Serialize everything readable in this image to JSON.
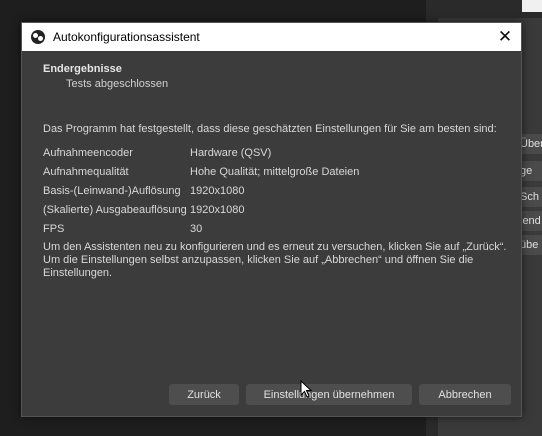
{
  "background": {
    "side_buttons": [
      "Über",
      "ge",
      "Sch",
      "lend",
      "übe"
    ]
  },
  "dialog": {
    "title": "Autokonfigurationsassistent",
    "close_glyph": "✕",
    "heading": "Endergebnisse",
    "subheading": "Tests abgeschlossen",
    "intro": "Das Programm hat festgestellt, dass diese geschätzten Einstellungen für Sie am besten sind:",
    "settings": [
      {
        "key": "Aufnahmeencoder",
        "value": "Hardware (QSV)"
      },
      {
        "key": "Aufnahmequalität",
        "value": "Hohe Qualität; mittelgroße Dateien"
      },
      {
        "key": "Basis-(Leinwand-)Auflösung",
        "value": "1920x1080"
      },
      {
        "key": "(Skalierte) Ausgabeauflösung",
        "value": "1920x1080"
      },
      {
        "key": "FPS",
        "value": "30"
      }
    ],
    "notice": "Um den Assistenten neu zu konfigurieren und es erneut zu versuchen, klicken Sie auf „Zurück“. Um die Einstellungen selbst anzupassen, klicken Sie auf „Abbrechen“ und öffnen Sie die Einstellungen.",
    "buttons": {
      "back": "Zurück",
      "apply": "Einstellungen übernehmen",
      "cancel": "Abbrechen"
    }
  }
}
